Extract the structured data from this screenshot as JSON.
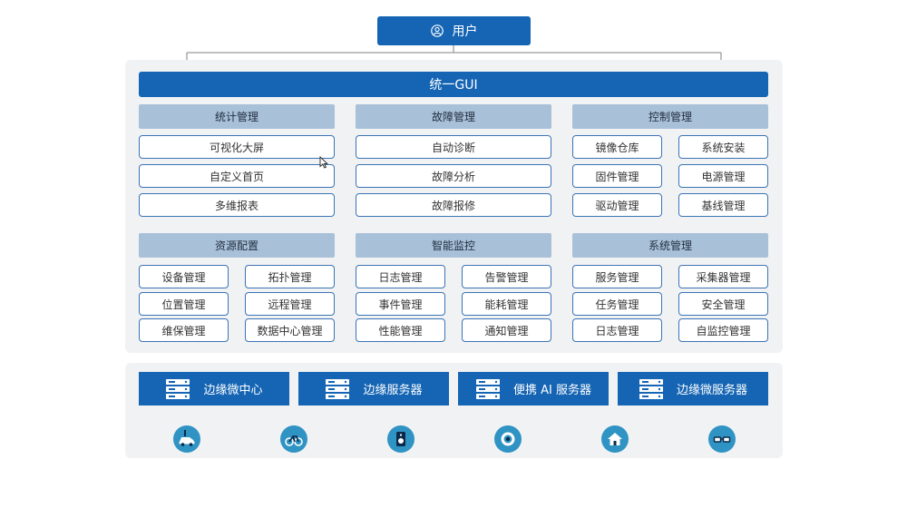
{
  "user": {
    "label": "用户"
  },
  "gui": {
    "label": "统一GUI"
  },
  "groups": [
    {
      "header": "统计管理",
      "items": [
        "可视化大屏",
        "自定义首页",
        "多维报表"
      ]
    },
    {
      "header": "故障管理",
      "items": [
        "自动诊断",
        "故障分析",
        "故障报修"
      ]
    },
    {
      "header": "控制管理",
      "items": [
        "镜像仓库",
        "系统安装",
        "固件管理",
        "电源管理",
        "驱动管理",
        "基线管理"
      ]
    },
    {
      "header": "资源配置",
      "items": [
        "设备管理",
        "拓扑管理",
        "位置管理",
        "远程管理",
        "维保管理",
        "数据中心管理"
      ]
    },
    {
      "header": "智能监控",
      "items": [
        "日志管理",
        "告警管理",
        "事件管理",
        "能耗管理",
        "性能管理",
        "通知管理"
      ]
    },
    {
      "header": "系统管理",
      "items": [
        "服务管理",
        "采集器管理",
        "任务管理",
        "安全管理",
        "日志管理",
        "自监控管理"
      ]
    }
  ],
  "devices": [
    "边缘微中心",
    "边缘服务器",
    "便携 AI 服务器",
    "边缘微服务器"
  ],
  "end_devices": [
    "car-icon",
    "bicycle-icon",
    "speaker-icon",
    "camera-icon",
    "home-icon",
    "glasses-icon"
  ],
  "colors": {
    "primary": "#1565b4",
    "header": "#a9c0d9",
    "panel": "#f1f2f4",
    "border": "#3a74b5",
    "end_device": "#2f93c4"
  }
}
